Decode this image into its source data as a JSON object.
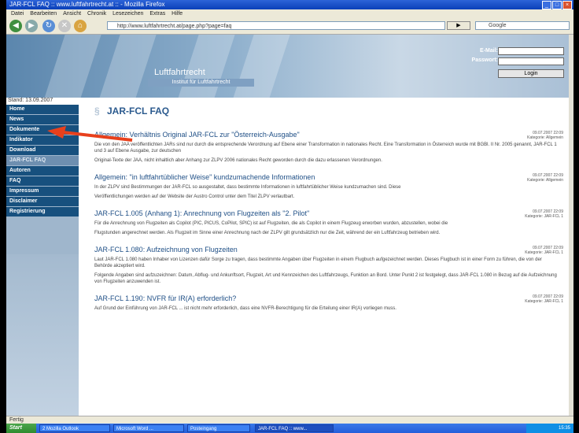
{
  "browser": {
    "title": "JAR-FCL FAQ :: www.luftfahrtrecht.at :: - Mozilla Firefox",
    "menu": [
      "Datei",
      "Bearbeiten",
      "Ansicht",
      "Chronik",
      "Lesezeichen",
      "Extras",
      "Hilfe"
    ],
    "url": "http://www.luftfahrtrecht.at/page.php?page=faq",
    "search_placeholder": "Google",
    "go_label": "",
    "status": "Fertig"
  },
  "header": {
    "site_title": "Luftfahrtrecht",
    "subtitle": "Institut für Luftfahrtrecht",
    "email_label": "E-Mail:",
    "password_label": "Passwort:",
    "login_label": "Login"
  },
  "date_label": "Stand: 13.09.2007",
  "sidebar": {
    "items": [
      {
        "label": "Home"
      },
      {
        "label": "News"
      },
      {
        "label": "Dokumente"
      },
      {
        "label": "Indikator"
      },
      {
        "label": "Download"
      },
      {
        "label": "JAR-FCL FAQ"
      },
      {
        "label": "Autoren"
      },
      {
        "label": "FAQ"
      },
      {
        "label": "Impressum"
      },
      {
        "label": "Disclaimer"
      },
      {
        "label": "Registrierung"
      }
    ]
  },
  "main": {
    "title": "JAR-FCL FAQ",
    "articles": [
      {
        "title": "Allgemein: Verhältnis Original JAR-FCL zur \"Österreich-Ausgabe\"",
        "meta1": "09.07.2007 22:09",
        "meta2": "Kategorie: Allgemein",
        "text1": "Die von den JAA veröffentlichten JARs sind nur durch die entsprechende Verordnung auf Ebene einer Transformation in nationales Recht. Eine Transformation in Österreich wurde mit BGBl. II Nr. 2005 genannt, JAR-FCL 1 und 3 auf Ebene Ausgabe, zur deutschen",
        "text2": "Original-Texte der JAA, nicht inhaltlich aber Anhang zur ZLPV 2006 nationales Recht geworden durch die dazu erlassenen Verordnungen."
      },
      {
        "title": "Allgemein: \"in luftfahrtüblicher Weise\" kundzumachende Informationen",
        "meta1": "09.07.2007 22:09",
        "meta2": "Kategorie: Allgemein",
        "text1": "In der ZLPV sind Bestimmungen der JAR-FCL so ausgestaltet, dass bestimmte Informationen in luftfahrtüblicher Weise kundzumachen sind. Diese",
        "text2": "Veröffentlichungen werden auf der Website der Austro Control unter dem Titel ZLPV verlautbart."
      },
      {
        "title": "JAR-FCL 1.005 (Anhang 1): Anrechnung von Flugzeiten als \"2. Pilot\"",
        "meta1": "09.07.2007 22:09",
        "meta2": "Kategorie: JAR-FCL 1",
        "text1": "Für die Anrechnung von Flugzeiten als Copilot (PIC, PICUS, CoPilot, SPIC) ist auf Flugzeiten, die als Copilot in einem Flugzeug erworben wurden, abzustellen, wobei die",
        "text2": "Flugstunden angerechnet werden. Als Flugzeit im Sinne einer Anrechnung nach der ZLPV gilt grundsätzlich nur die Zeit, während der ein Luftfahrzeug betrieben wird."
      },
      {
        "title": "JAR-FCL 1.080: Aufzeichnung von Flugzeiten",
        "meta1": "09.07.2007 22:09",
        "meta2": "Kategorie: JAR-FCL 1",
        "text1": "Laut JAR-FCL 1.080 haben Inhaber von Lizenzen dafür Sorge zu tragen, dass bestimmte Angaben über Flugzeiten in einem Flugbuch aufgezeichnet werden. Dieses Flugbuch ist in einer Form zu führen, die von der Behörde akzeptiert wird.",
        "text2": "Folgende Angaben sind aufzuzeichnen: Datum, Abflug- und Ankunftsort, Flugzeit, Art und Kennzeichen des Luftfahrzeugs, Funktion an Bord. Unter Punkt 2 ist festgelegt, dass JAR-FCL 1.080 in Bezug auf die Aufzeichnung von Flugzeiten anzuwenden ist."
      },
      {
        "title": "JAR-FCL 1.190: NVFR für IR(A) erforderlich?",
        "meta1": "09.07.2007 22:09",
        "meta2": "Kategorie: JAR-FCL 1",
        "text1": "Auf Grund der Einführung von JAR-FCL ... ist nicht mehr erforderlich, dass eine NVFR-Berechtigung für die Erteilung einer IR(A) vorliegen muss.",
        "text2": ""
      }
    ]
  },
  "taskbar": {
    "start": "Start",
    "tasks": [
      "2 Mozilla Outlook",
      "Microsoft Word ...",
      "Posteingang",
      "JAR-FCL FAQ :: www..."
    ],
    "clock": "15:35"
  },
  "colors": {
    "accent": "#17507e",
    "link": "#1f4f86",
    "arrow": "#e8401c"
  }
}
